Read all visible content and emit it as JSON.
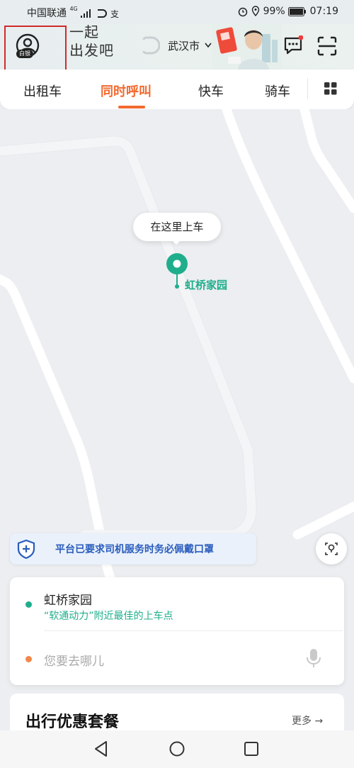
{
  "status_bar": {
    "carrier": "中国联通",
    "network": "4G",
    "battery": "99%",
    "time": "07:19"
  },
  "header": {
    "member_badge": "白银",
    "slogan_line1": "一起",
    "slogan_line2": "出发吧",
    "city": "武汉市"
  },
  "tabs": [
    {
      "label": "出租车",
      "active": false
    },
    {
      "label": "同时呼叫",
      "active": true
    },
    {
      "label": "快车",
      "active": false
    },
    {
      "label": "骑车",
      "active": false
    }
  ],
  "map": {
    "callout": "在这里上车",
    "pin_label": "虹桥家园"
  },
  "notice": {
    "text": "平台已要求司机服务时务必佩戴口罩"
  },
  "trip": {
    "pickup_name": "虹桥家园",
    "pickup_hint": "“软通动力”附近最佳的上车点",
    "destination_placeholder": "您要去哪儿"
  },
  "promo": {
    "title": "出行优惠套餐",
    "more": "更多 →"
  },
  "colors": {
    "accent": "#f26a2e",
    "green": "#1fae8c",
    "notice_blue": "#2a5dbd",
    "highlight_box": "#d22a2a"
  }
}
